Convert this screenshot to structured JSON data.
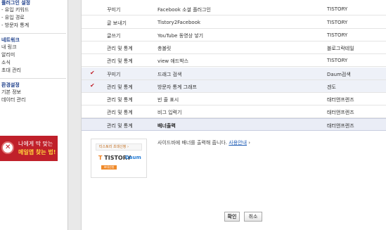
{
  "sidebar": {
    "plugin_heading": "플러그인 설정",
    "plugin_items": [
      "- 유입 키워드",
      "- 유입 경로",
      "- 방문자 통계"
    ],
    "network_heading": "네트워크",
    "network_items": [
      "내 링크",
      "알리미",
      "소식",
      "초대 관리"
    ],
    "env_heading": "환경설정",
    "env_items": [
      "기본 정보",
      "데이터 관리"
    ],
    "banner_line1": "나에게 딱 맞는",
    "banner_line2": "메일앱 찾는 법!"
  },
  "plugins": [
    {
      "checked": false,
      "category": "꾸미기",
      "name": "Facebook 소셜 플러그인",
      "author": "TISTORY"
    },
    {
      "checked": false,
      "category": "글 보내기",
      "name": "Tistory2Facebook",
      "author": "TISTORY"
    },
    {
      "checked": false,
      "category": "글쓰기",
      "name": "YouTube 동영상 넣기",
      "author": "TISTORY"
    },
    {
      "checked": false,
      "category": "관리 및 통계",
      "name": "총볼릿",
      "author": "블로그락테일"
    },
    {
      "checked": false,
      "category": "관리 및 통계",
      "name": "view 애드박스",
      "author": "TISTORY"
    },
    {
      "checked": true,
      "category": "꾸미기",
      "name": "드래그 검색",
      "author": "Daum검색"
    },
    {
      "checked": true,
      "category": "관리 및 통계",
      "name": "방문자 통계 그래프",
      "author": "겐도"
    },
    {
      "checked": false,
      "category": "관리 및 통계",
      "name": "빈 줄 표시",
      "author": "태터앤프렌즈"
    },
    {
      "checked": false,
      "category": "관리 및 통계",
      "name": "비그 입력기",
      "author": "태터앤프렌즈"
    },
    {
      "checked": false,
      "category": "관리 및 통계",
      "name": "배너출력",
      "author": "태터앤프렌즈",
      "selected": true
    }
  ],
  "check_mark": "✔",
  "detail": {
    "thumb_top": "티스토리 초대신청 ›",
    "thumb_logo_prefix": "T",
    "thumb_logo": "TISTORY",
    "thumb_daum": "Daum",
    "thumb_badge": "초대신청",
    "description": "사이드바에 배너를 출력해 줍니다.",
    "more_link": "사용안내",
    "more_arrow": " ›"
  },
  "buttons": {
    "confirm": "확인",
    "cancel": "취소"
  },
  "colors": {
    "accent_red": "#c0202a",
    "heading_blue": "#1c3e8a"
  }
}
